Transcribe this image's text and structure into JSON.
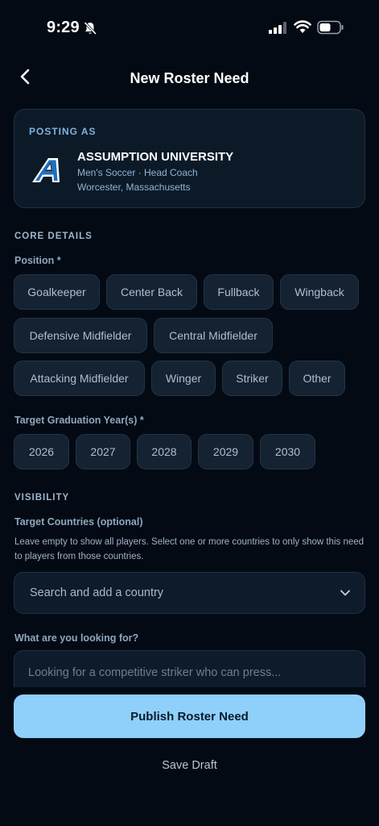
{
  "status_bar": {
    "time": "9:29"
  },
  "header": {
    "title": "New Roster Need"
  },
  "posting": {
    "label": "POSTING AS",
    "university": "ASSUMPTION UNIVERSITY",
    "subtitle": "Men's Soccer · Head Coach",
    "location": "Worcester, Massachusetts"
  },
  "core_details": {
    "section_title": "CORE DETAILS",
    "position_label": "Position *",
    "positions": [
      "Goalkeeper",
      "Center Back",
      "Fullback",
      "Wingback",
      "Defensive Midfielder",
      "Central Midfielder",
      "Attacking Midfielder",
      "Winger",
      "Striker",
      "Other"
    ],
    "grad_label": "Target Graduation Year(s) *",
    "years": [
      "2026",
      "2027",
      "2028",
      "2029",
      "2030"
    ]
  },
  "visibility": {
    "section_title": "VISIBILITY",
    "countries_label": "Target Countries (optional)",
    "help_text": "Leave empty to show all players. Select one or more countries to only show this need to players from those countries.",
    "country_placeholder": "Search and add a country",
    "looking_label": "What are you looking for?",
    "looking_placeholder": "Looking for a competitive striker who can press..."
  },
  "actions": {
    "publish": "Publish Roster Need",
    "draft": "Save Draft"
  },
  "colors": {
    "background": "#040a13",
    "accent": "#8fd0fb",
    "card": "#0c1a28"
  }
}
